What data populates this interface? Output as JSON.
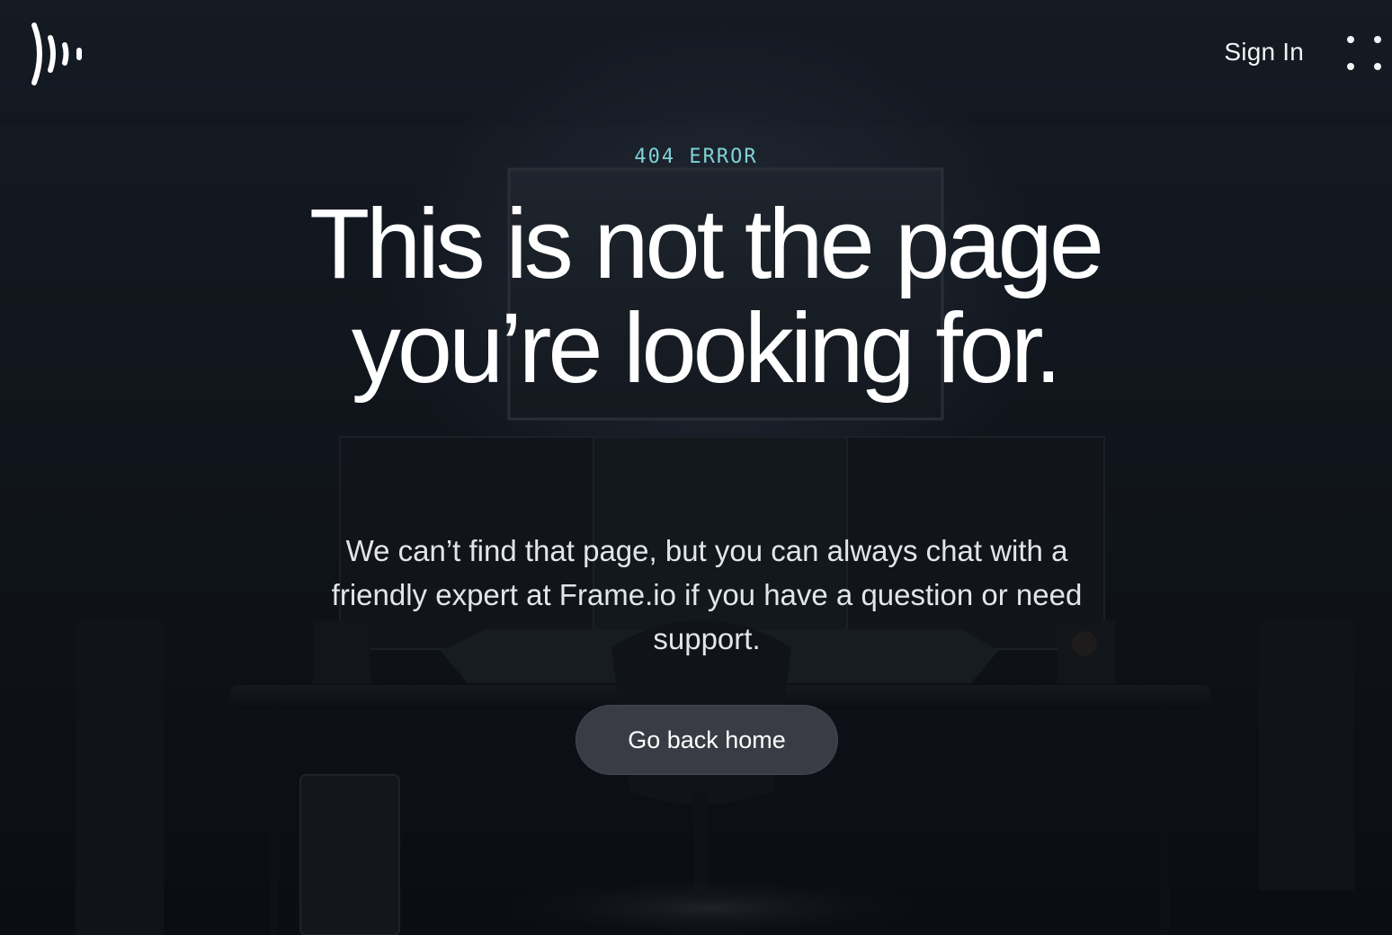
{
  "header": {
    "logo_icon": "frameio-logo-icon",
    "sign_in_label": "Sign In",
    "menu_icon": "grid-dots-icon"
  },
  "main": {
    "eyebrow": "404 ERROR",
    "headline": "This is not the page you’re looking for.",
    "subtext": "We can’t find that page, but you can always chat with a friendly expert at Frame.io if you have a question or need support.",
    "cta_label": "Go back home"
  },
  "colors": {
    "accent": "#7fd3d8",
    "text": "#ffffff",
    "button_bg": "#3e404a",
    "background": "#10141a"
  }
}
